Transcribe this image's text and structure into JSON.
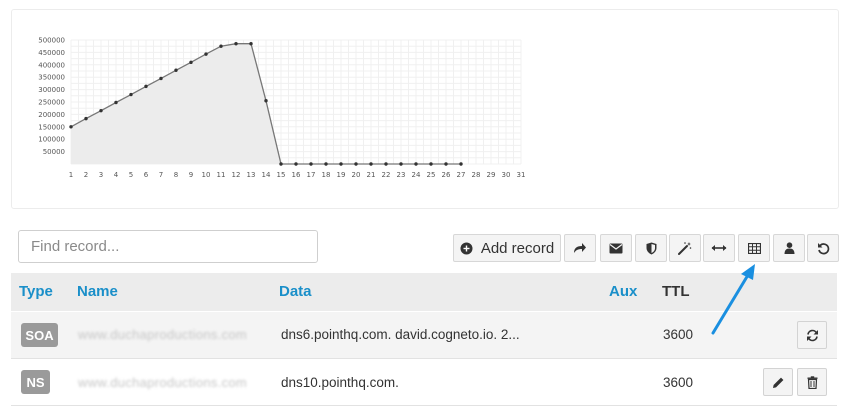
{
  "chart_data": {
    "type": "area",
    "x": [
      1,
      2,
      3,
      4,
      5,
      6,
      7,
      8,
      9,
      10,
      11,
      12,
      13,
      14,
      15,
      16,
      17,
      18,
      19,
      20,
      21,
      22,
      23,
      24,
      25,
      26,
      27
    ],
    "x_ticks": [
      "1",
      "2",
      "3",
      "4",
      "5",
      "6",
      "7",
      "8",
      "9",
      "10",
      "11",
      "12",
      "13",
      "14",
      "15",
      "16",
      "17",
      "18",
      "19",
      "20",
      "21",
      "22",
      "23",
      "24",
      "25",
      "26",
      "27",
      "28",
      "29",
      "30",
      "31"
    ],
    "y_ticks": [
      "50000",
      "100000",
      "150000",
      "200000",
      "250000",
      "300000",
      "350000",
      "400000",
      "450000",
      "500000"
    ],
    "values": [
      150000,
      183000,
      215000,
      248000,
      280000,
      313000,
      345000,
      378000,
      410000,
      443000,
      475000,
      485000,
      485000,
      255000,
      0,
      0,
      0,
      0,
      0,
      0,
      0,
      0,
      0,
      0,
      0,
      0,
      0
    ],
    "xlim": [
      1,
      31
    ],
    "ylim": [
      0,
      500000
    ],
    "grid": true,
    "line_color": "#777777",
    "fill_color": "#ececec"
  },
  "search": {
    "placeholder": "Find record..."
  },
  "toolbar": {
    "add_label": "Add record",
    "buttons": [
      "share-icon",
      "envelope-icon",
      "shield-icon",
      "magic-wand-icon",
      "arrows-horizontal-icon",
      "table-icon",
      "user-icon",
      "undo-icon"
    ]
  },
  "table": {
    "headers": {
      "type": "Type",
      "name": "Name",
      "data": "Data",
      "aux": "Aux",
      "ttl": "TTL"
    },
    "rows": [
      {
        "type": "SOA",
        "name": "www.duchaproductions.com",
        "data": "dns6.pointhq.com. david.cogneto.io. 2...",
        "ttl": "3600"
      },
      {
        "type": "NS",
        "name": "www.duchaproductions.com",
        "data": "dns10.pointhq.com.",
        "ttl": "3600"
      }
    ]
  },
  "colors": {
    "accent": "#1a8fc9",
    "badge": "#9a9a9a",
    "annotation_arrow": "#1a8fe0"
  }
}
